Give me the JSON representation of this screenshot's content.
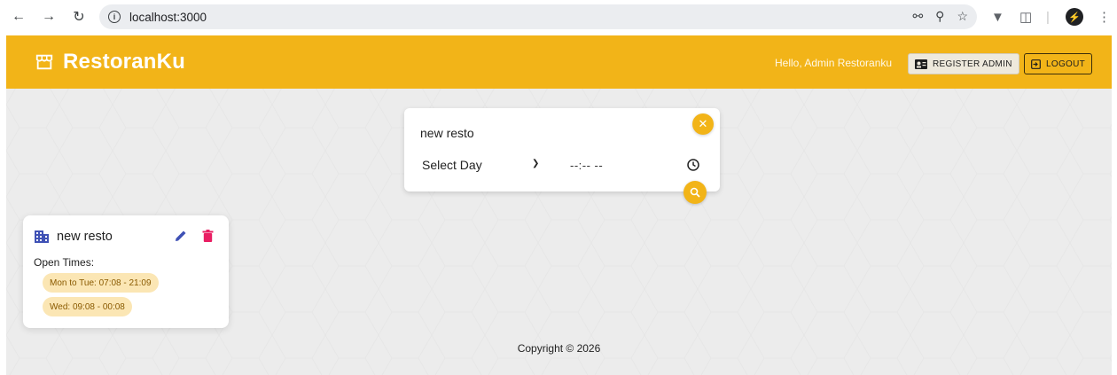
{
  "browser": {
    "url": "localhost:3000",
    "back_icon": "arrow-left-icon",
    "forward_icon": "arrow-right-icon",
    "reload_icon": "reload-icon"
  },
  "header": {
    "brand": "RestoranKu",
    "greeting": "Hello, Admin Restoranku",
    "register_label": "REGISTER ADMIN",
    "logout_label": "LOGOUT",
    "colors": {
      "primary": "#f2b418"
    }
  },
  "search": {
    "query": "new resto",
    "day_selected": "Select Day",
    "time_value": "--:-- --"
  },
  "restaurants": [
    {
      "name": "new resto",
      "open_label": "Open Times:",
      "times": [
        "Mon to Tue: 07:08 - 21:09",
        "Wed: 09:08 - 00:08"
      ]
    }
  ],
  "footer": {
    "copyright": "Copyright © 2026"
  }
}
